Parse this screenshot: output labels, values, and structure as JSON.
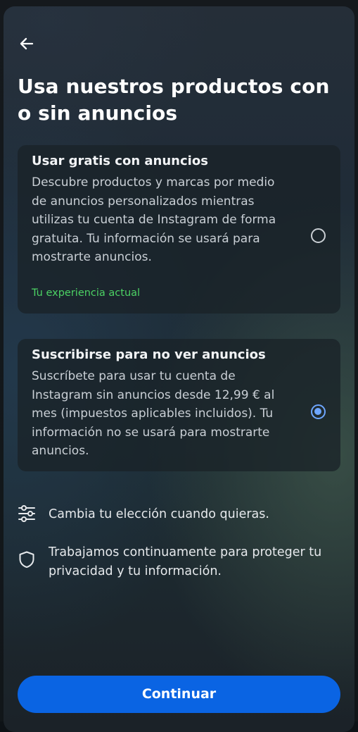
{
  "header": {
    "back_icon": "arrow-left-icon",
    "title": "Usa nuestros productos con o sin anuncios"
  },
  "options": [
    {
      "title": "Usar gratis con anuncios",
      "description": "Descubre productos y marcas por medio de anuncios personalizados mientras utilizas tu cuenta de Instagram de forma gratuita. Tu información se usará para mostrarte anuncios.",
      "status": "Tu experiencia actual",
      "selected": false
    },
    {
      "title": "Suscribirse para no ver anuncios",
      "description": "Suscríbete para usar tu cuenta de Instagram sin anuncios desde 12,99 € al mes (impuestos aplicables incluidos). Tu información no se usará para mostrarte anuncios.",
      "selected": true
    }
  ],
  "info": [
    {
      "icon": "sliders-icon",
      "text": "Cambia tu elección cuando quieras."
    },
    {
      "icon": "shield-icon",
      "text": "Trabajamos continuamente para proteger tu privacidad y tu información."
    }
  ],
  "footer": {
    "continue_label": "Continuar"
  },
  "colors": {
    "accent": "#0a64e3",
    "radio_selected": "#6ea6ff",
    "status_green": "#4cd264"
  }
}
